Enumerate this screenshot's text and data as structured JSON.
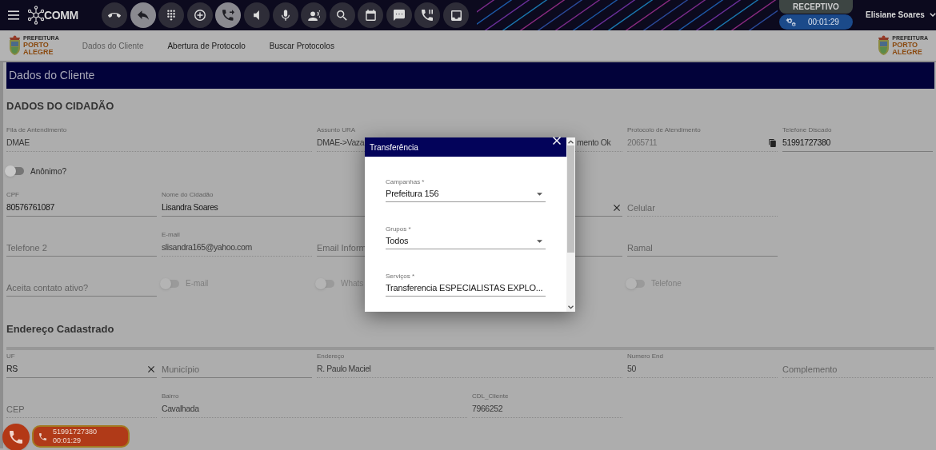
{
  "header": {
    "brand": "COMM",
    "toolbar": [
      {
        "kind": "hangup",
        "active": false
      },
      {
        "kind": "reply",
        "active": true
      },
      {
        "kind": "dialpad",
        "active": false
      },
      {
        "kind": "add",
        "active": false
      },
      {
        "kind": "forward",
        "active": true
      },
      {
        "kind": "volume",
        "active": false
      },
      {
        "kind": "mic",
        "active": false
      },
      {
        "kind": "speaker",
        "active": false
      },
      {
        "kind": "search",
        "active": false
      },
      {
        "kind": "calendar",
        "active": false
      },
      {
        "kind": "chat",
        "active": false
      },
      {
        "kind": "hold",
        "active": false
      },
      {
        "kind": "inbox",
        "active": false
      }
    ],
    "mode": "RECEPTIVO",
    "timer": "00:01:29",
    "user": "Elisiane Soares"
  },
  "logos": [
    {
      "line1": "PREFEITURA",
      "line2": "PORTO",
      "line3": "ALEGRE"
    },
    {
      "line1": "PREFEITURA",
      "line2": "PORTO",
      "line3": "ALEGRE"
    }
  ],
  "tabs": [
    {
      "label": "Dados do Cliente",
      "selected": true
    },
    {
      "label": "Abertura de Protocolo",
      "selected": false
    },
    {
      "label": "Buscar Protocolos",
      "selected": false
    }
  ],
  "panel_title": "Dados do Cliente",
  "citizen": {
    "heading": "DADOS DO CIDADÃO",
    "fields": [
      {
        "kind": "field",
        "label": "Fila de Antendimento",
        "value": "DMAE",
        "readonly": true
      },
      {
        "kind": "field",
        "label": "Assunto URA",
        "value": "DMAE->Vaza",
        "value_tail": "mento Ok",
        "readonly": true
      },
      {
        "kind": "field",
        "label": "Protocolo de Atendimento",
        "value": "2065711",
        "readonly": true,
        "disabled": true,
        "copy": true
      },
      {
        "kind": "field",
        "label": "Telefone Discado",
        "value": "51991727380",
        "readonly": false
      },
      {
        "kind": "toggle",
        "label": "Anônimo?",
        "on": false,
        "disabled": false
      },
      {
        "kind": "field",
        "label": "CPF",
        "value": "80576761087",
        "readonly": false
      },
      {
        "kind": "field",
        "label": "Nome do Cidadão",
        "value": "Lisandra Soares",
        "readonly": false,
        "clearable": true
      },
      {
        "kind": "field",
        "placeholder": "Celular",
        "readonly": true
      },
      {
        "kind": "field",
        "placeholder": "Telefone 2",
        "readonly": false
      },
      {
        "kind": "field",
        "label": "E-mail",
        "value": "slisandra165@yahoo.com",
        "readonly": true
      },
      {
        "kind": "field",
        "placeholder": "Email Inform",
        "readonly": false
      },
      {
        "kind": "field",
        "placeholder": "Ramal",
        "readonly": false
      },
      {
        "kind": "field",
        "placeholder": "Aceita contato ativo?",
        "readonly": false
      },
      {
        "kind": "toggle",
        "label": "E-mail",
        "on": false,
        "disabled": true
      },
      {
        "kind": "toggle",
        "label": "Whats",
        "on": false,
        "disabled": true
      },
      {
        "kind": "toggle",
        "label": "Telefone",
        "on": false,
        "disabled": true
      }
    ]
  },
  "address": {
    "heading": "Endereço Cadastrado",
    "fields": [
      {
        "kind": "field",
        "label": "UF",
        "value": "RS",
        "readonly": false,
        "clearable": true
      },
      {
        "kind": "field",
        "placeholder": "Município",
        "readonly": false
      },
      {
        "kind": "field",
        "label": "Endereço",
        "value": "R. Paulo Maciel",
        "readonly": true
      },
      {
        "kind": "field",
        "label": "Numero End",
        "value": "50",
        "readonly": true
      },
      {
        "kind": "field",
        "placeholder": "Complemento",
        "readonly": true
      },
      {
        "kind": "field",
        "placeholder": "CEP",
        "readonly": true
      },
      {
        "kind": "field",
        "label": "Bairro",
        "value": "Cavalhada",
        "readonly": true
      },
      {
        "kind": "field",
        "label": "CDL_Cliente",
        "value": "7966252",
        "readonly": true
      }
    ]
  },
  "dialog": {
    "title": "Transferência",
    "selects": [
      {
        "label": "Campanhas *",
        "value": "Prefeitura 156"
      },
      {
        "label": "Grupos *",
        "value": "Todos"
      },
      {
        "label": "Serviços *",
        "value": "Transferencia ESPECIALISTAS EXPLO..."
      }
    ]
  },
  "call_widget": {
    "number": "51991727380",
    "time": "00:01:29"
  }
}
